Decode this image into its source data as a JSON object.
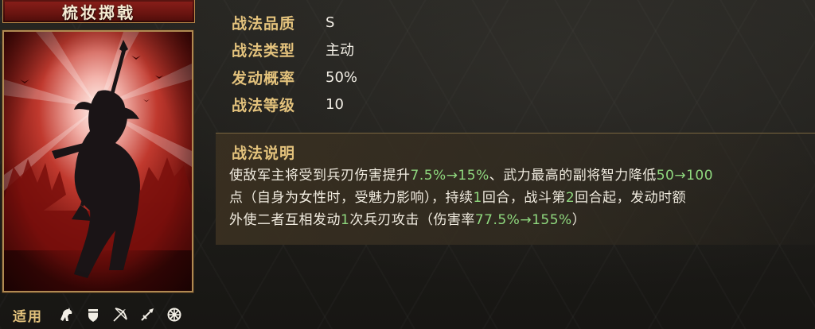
{
  "tactic": {
    "name": "梳妆掷戟"
  },
  "info": [
    {
      "label": "战法品质",
      "value": "S"
    },
    {
      "label": "战法类型",
      "value": "主动"
    },
    {
      "label": "发动概率",
      "value": "50%"
    },
    {
      "label": "战法等级",
      "value": "10"
    }
  ],
  "description": {
    "title": "战法说明",
    "line1_a": "使敌军主将受到兵刃伤害提升",
    "line1_b": "7.5%→15%",
    "line1_c": "、武力最高的副将智力降低",
    "line1_d": "50→100",
    "line2_a": "点（自身为女性时，受魅力影响），持续",
    "line2_b": "1",
    "line2_c": "回合，战斗第",
    "line2_d": "2",
    "line2_e": "回合起，发动时额",
    "line3_a": "外使二者互相发动",
    "line3_b": "1",
    "line3_c": "次兵刃攻击（伤害率",
    "line3_d": "77.5%→155%",
    "line3_e": "）",
    "highlight_color": "#8fd87e"
  },
  "units": {
    "label": "适用",
    "icons": [
      "cavalry-icon",
      "shield-icon",
      "bow-icon",
      "spear-icon",
      "siege-icon"
    ]
  },
  "colors": {
    "label_gold": "#e3c27c",
    "plaque_red": "#7a1a14",
    "frame_gold": "#b08a52"
  }
}
